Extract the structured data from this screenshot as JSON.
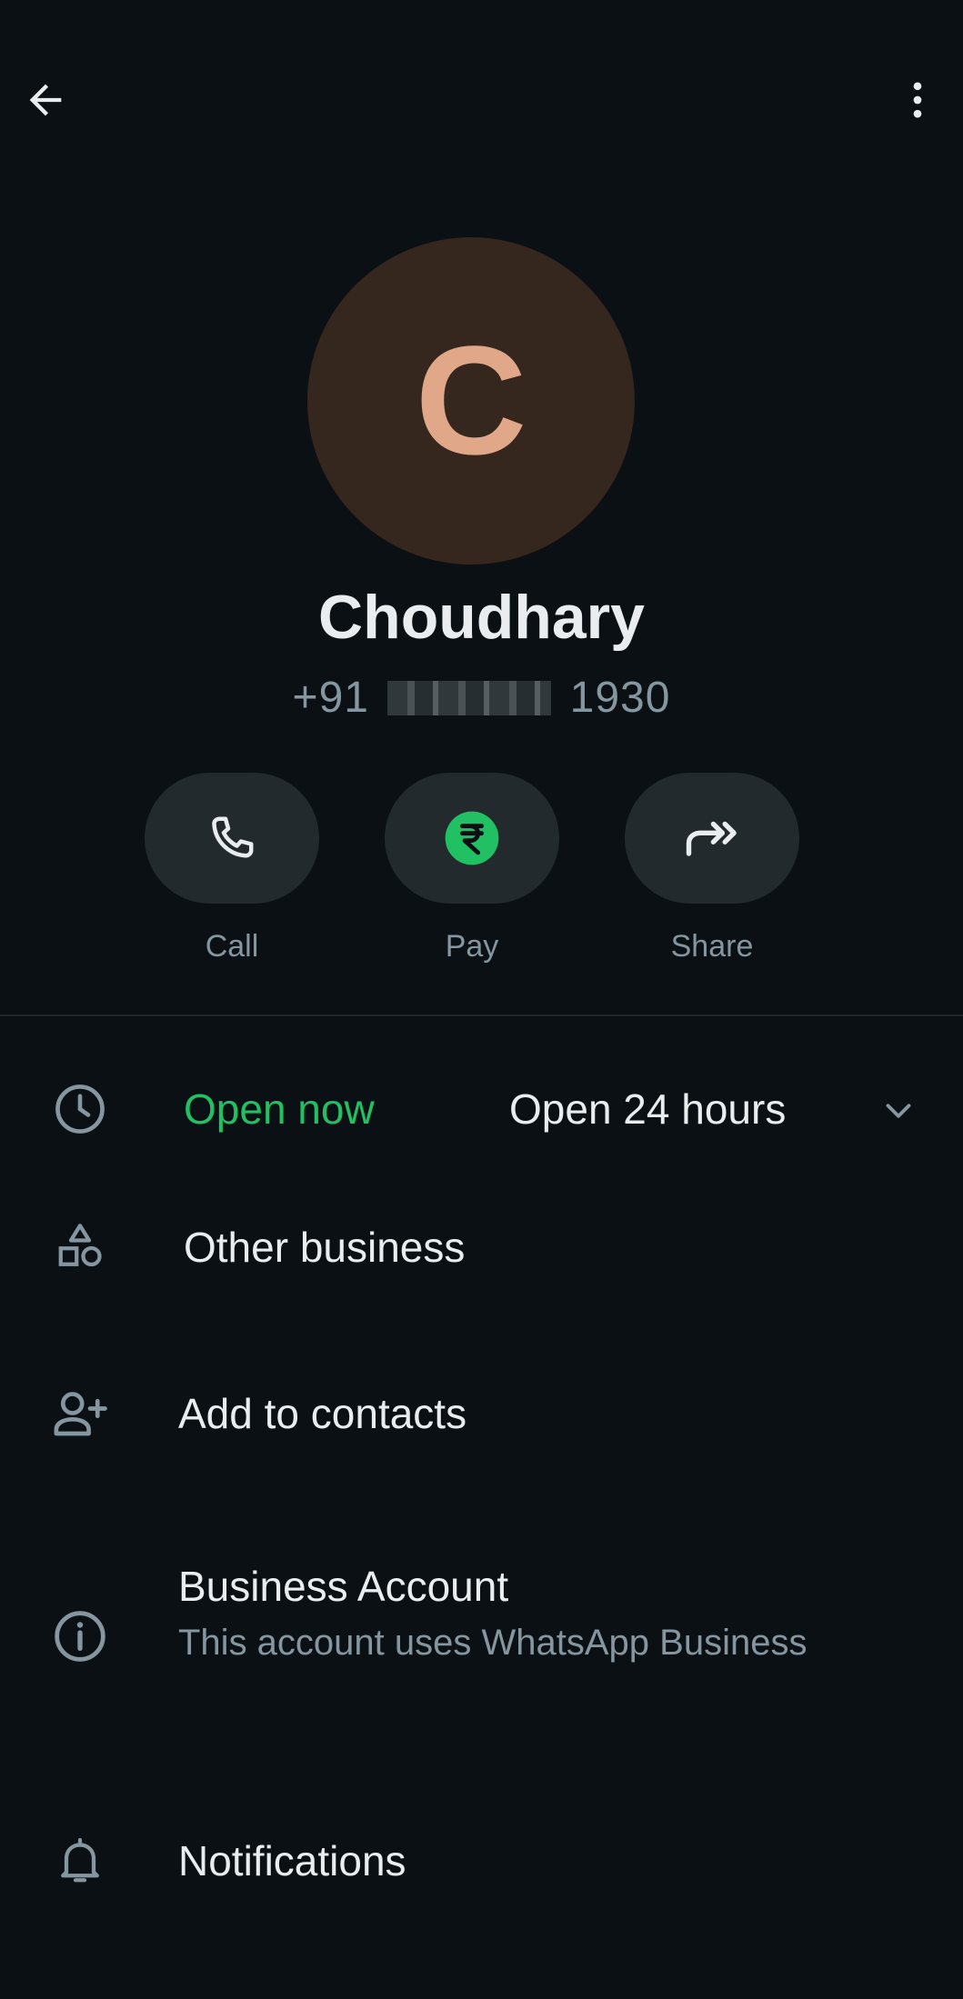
{
  "contact": {
    "avatar_letter": "C",
    "name": "Choudhary",
    "phone_prefix": "+91",
    "phone_suffix": "1930"
  },
  "actions": [
    {
      "label": "Call",
      "icon": "phone-icon"
    },
    {
      "label": "Pay",
      "icon": "rupee-icon"
    },
    {
      "label": "Share",
      "icon": "share-icon"
    }
  ],
  "hours": {
    "status": "Open now",
    "schedule": "Open 24 hours"
  },
  "category": "Other business",
  "add_contact": "Add to contacts",
  "business_account": {
    "title": "Business Account",
    "description": "This account uses WhatsApp Business"
  },
  "notifications": "Notifications",
  "colors": {
    "background": "#0b1014",
    "accent_green": "#21c063",
    "avatar_bg": "#35261e",
    "avatar_letter": "#e0a889",
    "secondary_text": "#8696a0"
  }
}
